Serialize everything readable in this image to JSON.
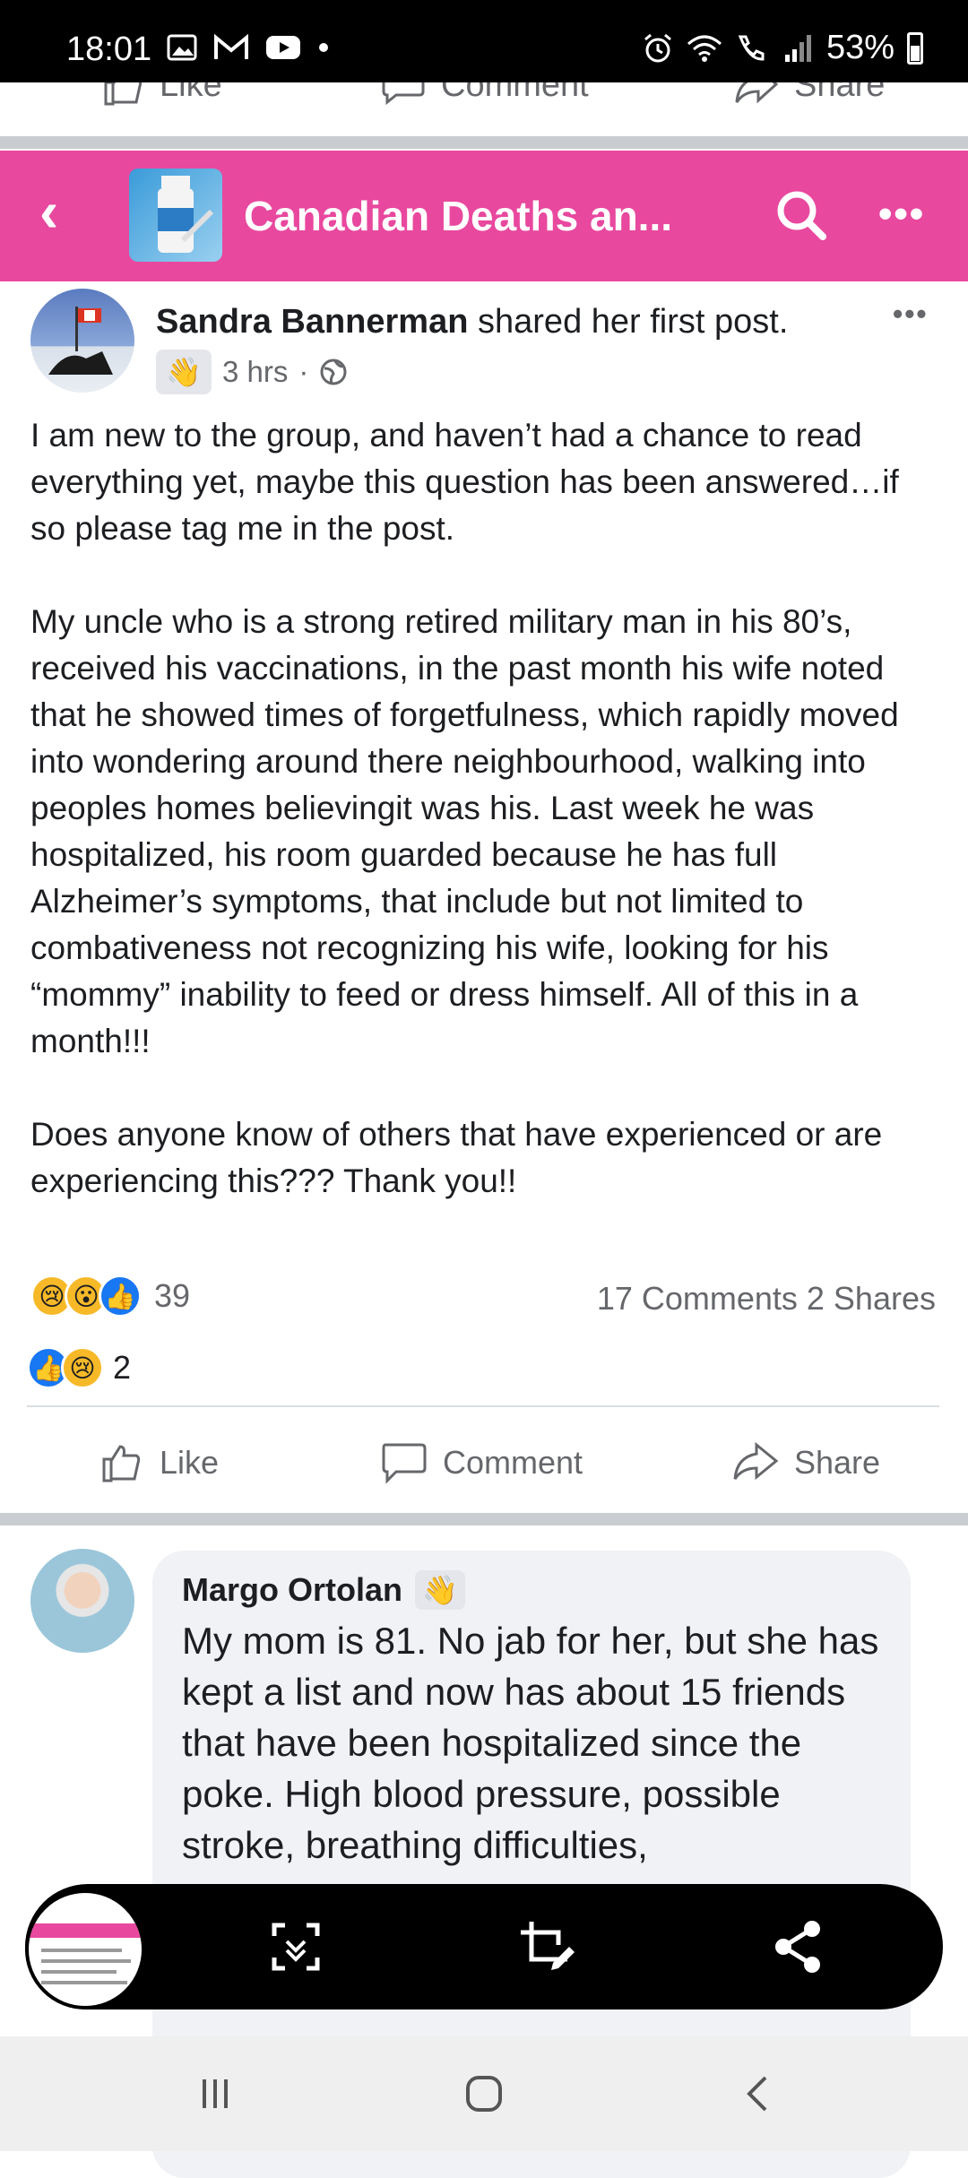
{
  "status_bar": {
    "time": "18:01",
    "battery": "53%",
    "icons": [
      "gallery-icon",
      "gmail-icon",
      "youtube-icon",
      "dot-icon",
      "alarm-icon",
      "wifi-icon",
      "wifi-calling-icon",
      "signal-icon",
      "battery-icon"
    ]
  },
  "top_actions": {
    "like": "Like",
    "comment": "Comment",
    "share": "Share"
  },
  "group_header": {
    "title": "Canadian Deaths an...",
    "back_icon": "chevron-left-icon",
    "search_icon": "search-icon",
    "more_icon": "more-horizontal-icon",
    "accent_color": "#e8489e"
  },
  "post": {
    "author": "Sandra Bannerman",
    "author_suffix": " shared her first post.",
    "time": "3 hrs",
    "meta_separator": "·",
    "paragraphs": [
      "I am new to the group, and haven’t had a chance to read everything yet, maybe this question has been answered…if so please tag me in the post.",
      "My uncle who is a strong retired military man in his 80’s, received his vaccinations, in the past month his wife noted that he showed times of forgetfulness, which rapidly moved into wondering around there neighbourhood, walking into peoples homes believingit was his. Last week he was hospitalized, his room  guarded because he has full Alzheimer’s symptoms, that include but not limited to combativeness not recognizing his wife, looking for his “mommy” inability to feed or dress himself. All of this in a month!!!",
      "Does anyone know of others that have experienced or are experiencing this??? Thank you!!"
    ],
    "reaction_count": "39",
    "comments_shares": "17 Comments  2 Shares",
    "second_reaction_count": "2",
    "actions": {
      "like": "Like",
      "comment": "Comment",
      "share": "Share"
    }
  },
  "comment": {
    "author": "Margo Ortolan",
    "text": "My mom is 81. No jab for her, but she has kept a list and now has about 15 friends that have been hospitalized since the poke. High blood pressure, possible stroke, breathing difficulties,"
  },
  "screenshot_toolbar": {
    "buttons": [
      "scroll-capture-icon",
      "crop-edit-icon",
      "share-icon"
    ]
  },
  "nav_bar": {
    "buttons": [
      "recent-apps-icon",
      "home-icon",
      "back-icon"
    ]
  }
}
